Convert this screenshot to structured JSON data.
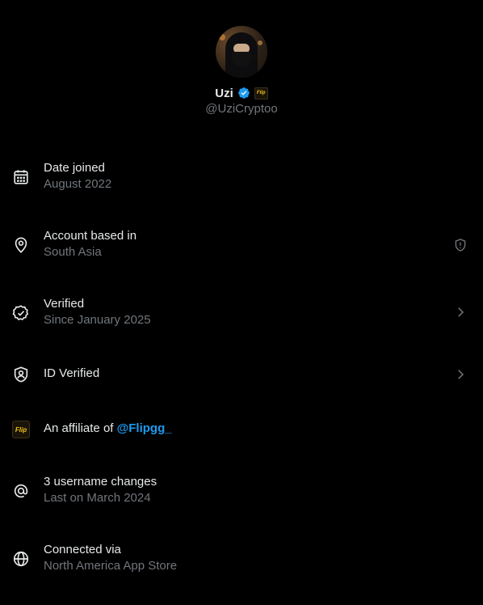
{
  "profile": {
    "name": "Uzi",
    "handle": "@UziCryptoo",
    "affiliate_badge_text": "Flip"
  },
  "rows": [
    {
      "icon": "calendar-icon",
      "label": "Date joined",
      "sub": "August 2022",
      "trail": ""
    },
    {
      "icon": "location-pin-icon",
      "label": "Account based in",
      "sub": "South Asia",
      "trail": "shield-alert-icon"
    },
    {
      "icon": "verified-check-icon",
      "label": "Verified",
      "sub": "Since January 2025",
      "trail": "chevron-right-icon"
    },
    {
      "icon": "id-badge-icon",
      "label": "ID Verified",
      "sub": "",
      "trail": "chevron-right-icon"
    },
    {
      "icon": "affiliate-logo-icon",
      "label_prefix": "An affiliate of ",
      "mention": "@Flipgg_",
      "logo_text": "Flip"
    },
    {
      "icon": "at-sign-icon",
      "label": "3 username changes",
      "sub": "Last on March 2024",
      "trail": ""
    },
    {
      "icon": "globe-icon",
      "label": "Connected via",
      "sub": "North America App Store",
      "trail": ""
    }
  ],
  "colors": {
    "background": "#000000",
    "primary_text": "#e7e9ea",
    "secondary_text": "#71767b",
    "accent": "#1d9bf0"
  }
}
